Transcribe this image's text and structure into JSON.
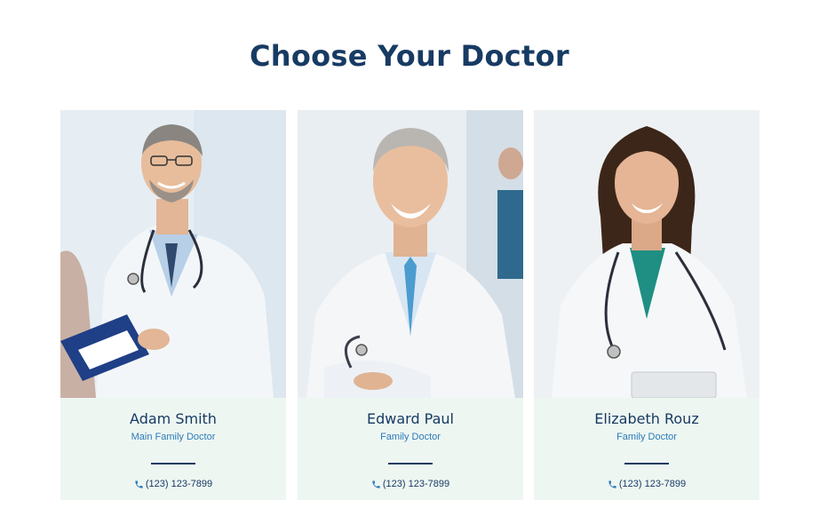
{
  "section": {
    "title": "Choose Your Doctor"
  },
  "doctors": [
    {
      "name": "Adam Smith",
      "role": "Main Family Doctor",
      "phone": "(123) 123-7899",
      "photo_icon": "doctor-photo-adam"
    },
    {
      "name": "Edward Paul",
      "role": "Family Doctor",
      "phone": "(123) 123-7899",
      "photo_icon": "doctor-photo-edward"
    },
    {
      "name": "Elizabeth Rouz",
      "role": "Family Doctor",
      "phone": "(123) 123-7899",
      "photo_icon": "doctor-photo-elizabeth"
    }
  ],
  "colors": {
    "heading": "#173b63",
    "accent": "#2b7bb9",
    "card_bg": "#eef6f2"
  }
}
